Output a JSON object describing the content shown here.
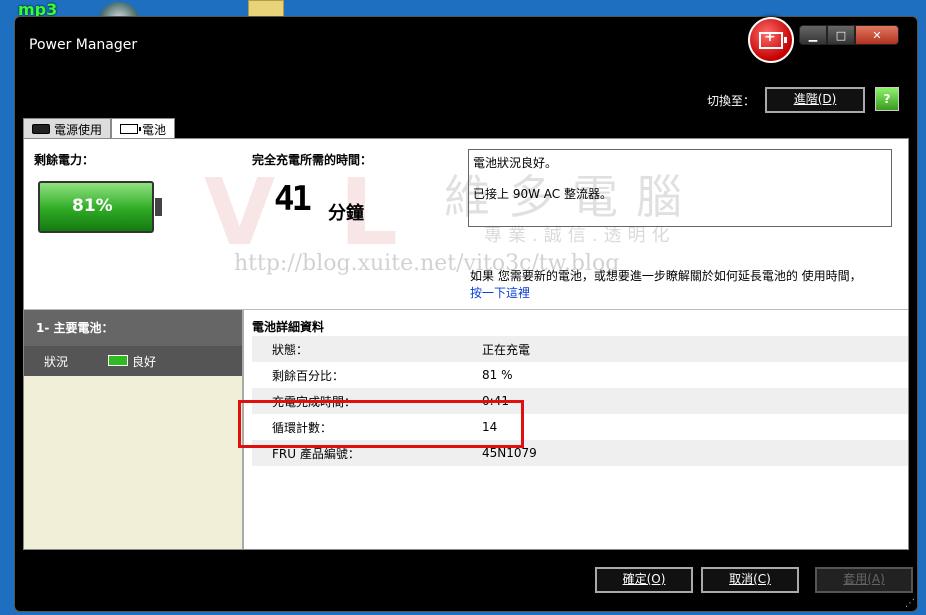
{
  "desktop": {
    "mp3_label": "mp3"
  },
  "window": {
    "title": "Power Manager"
  },
  "header": {
    "switch_label": "切換至：",
    "advanced_button": "進階(D)"
  },
  "tabs": [
    {
      "label": "電源使用"
    },
    {
      "label": "電池"
    }
  ],
  "battery": {
    "remaining_label": "剩餘電力：",
    "percent": "81%",
    "full_charge_label": "完全充電所需的時間：",
    "minutes": "41",
    "minutes_unit": "分鐘"
  },
  "status": {
    "line1": "電池狀況良好。",
    "line2": "已接上 90W AC 整流器。",
    "info_text": "如果 您需要新的電池，或想要進一步瞭解關於如何延長電池的 使用時間，",
    "info_link": "按一下這裡"
  },
  "left_panel": {
    "header": "1- 主要電池：",
    "status_key": "狀況",
    "status_value": "良好"
  },
  "details": {
    "title": "電池詳細資料",
    "rows": [
      {
        "key": "狀態：",
        "value": "正在充電"
      },
      {
        "key": "剩餘百分比：",
        "value": "81 %"
      },
      {
        "key": "充電完成時間：",
        "value": "0:41"
      },
      {
        "key": "循環計數：",
        "value": "14"
      },
      {
        "key": "FRU 產品編號：",
        "value": "45N1079"
      }
    ]
  },
  "buttons": {
    "ok": "確定(O)",
    "cancel": "取消(C)",
    "apply": "套用(A)"
  },
  "watermark": {
    "url": "http://blog.xuite.net/vito3c/tw.blog",
    "brand": "維多電腦",
    "slogan": "專業.誠信.透明化"
  }
}
